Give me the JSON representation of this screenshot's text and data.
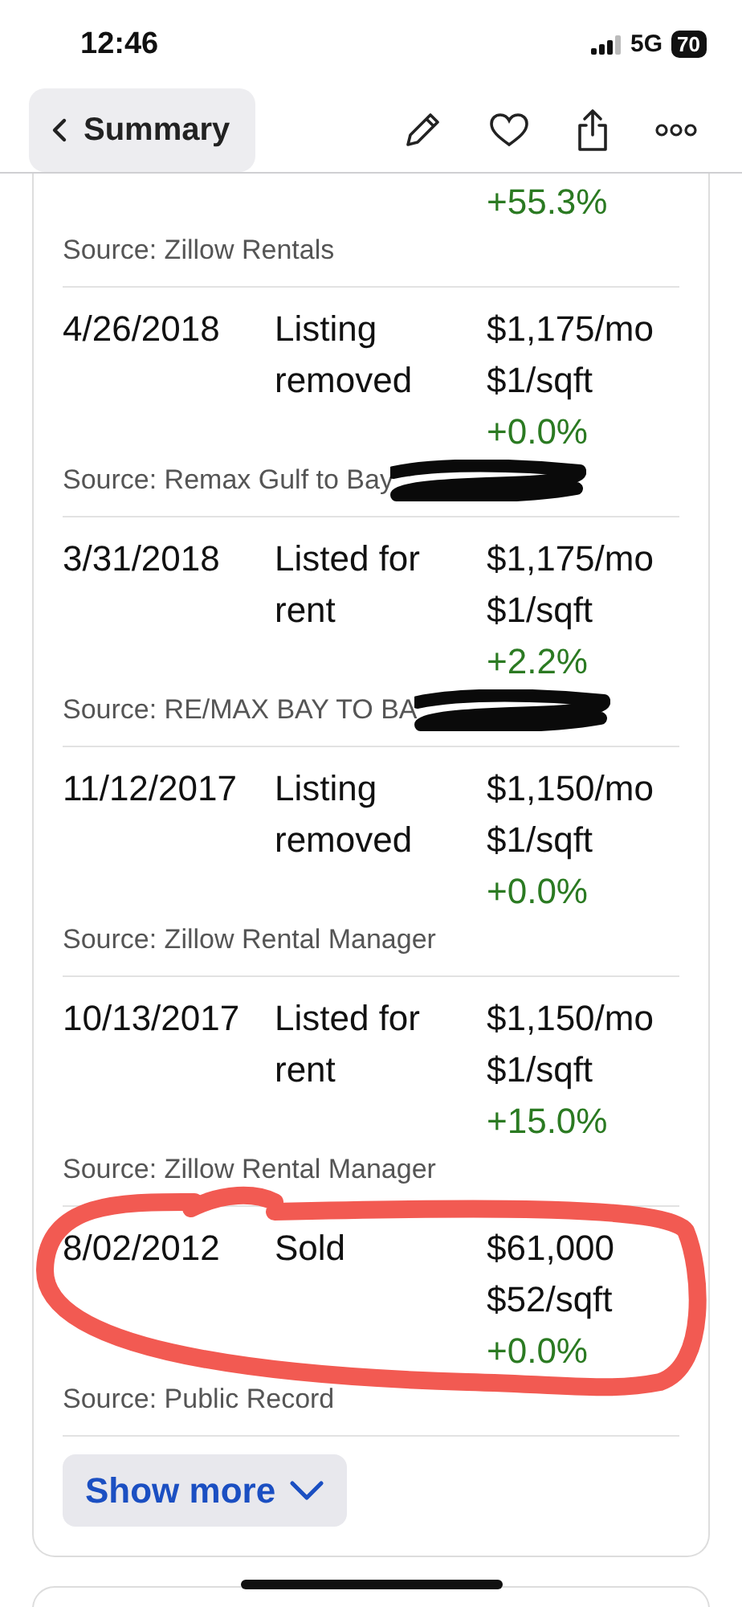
{
  "status_bar": {
    "time": "12:46",
    "network": "5G",
    "battery": "70"
  },
  "nav": {
    "back_label": "Summary"
  },
  "history": {
    "top_partial": {
      "change": "+55.3%",
      "source": "Source: Zillow Rentals"
    },
    "rows": [
      {
        "date": "4/26/2018",
        "event": "Listing removed",
        "price": "$1,175/mo",
        "price_per_sqft": "$1/sqft",
        "change": "+0.0%",
        "source": "Source: Remax Gulf to Bay",
        "source_redacted": true,
        "circled": false
      },
      {
        "date": "3/31/2018",
        "event": "Listed for rent",
        "price": "$1,175/mo",
        "price_per_sqft": "$1/sqft",
        "change": "+2.2%",
        "source": "Source: RE/MAX BAY TO BA",
        "source_redacted": true,
        "circled": false
      },
      {
        "date": "11/12/2017",
        "event": "Listing removed",
        "price": "$1,150/mo",
        "price_per_sqft": "$1/sqft",
        "change": "+0.0%",
        "source": "Source: Zillow Rental Manager",
        "source_redacted": false,
        "circled": false
      },
      {
        "date": "10/13/2017",
        "event": "Listed for rent",
        "price": "$1,150/mo",
        "price_per_sqft": "$1/sqft",
        "change": "+15.0%",
        "source": "Source: Zillow Rental Manager",
        "source_redacted": false,
        "circled": false
      },
      {
        "date": "8/02/2012",
        "event": "Sold",
        "price": "$61,000",
        "price_per_sqft": "$52/sqft",
        "change": "+0.0%",
        "source": "Source: Public Record",
        "source_redacted": false,
        "circled": true
      }
    ],
    "show_more": "Show more"
  }
}
